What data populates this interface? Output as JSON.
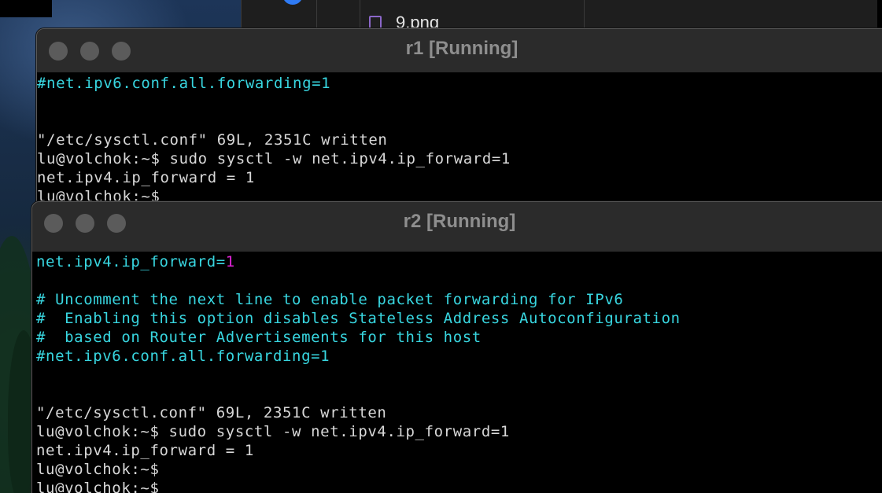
{
  "finder": {
    "file_name": "9.png",
    "file_icon": "image-file-icon"
  },
  "r1": {
    "title": "r1 [Running]",
    "lines": [
      "#net.ipv6.conf.all.forwarding=1",
      "",
      "",
      "\"/etc/sysctl.conf\" 69L, 2351C written",
      "lu@volchok:~$ sudo sysctl -w net.ipv4.ip_forward=1",
      "net.ipv4.ip_forward = 1",
      "lu@volchok:~$"
    ]
  },
  "r2": {
    "title": "r2 [Running]",
    "line0_key": "net.ipv4.ip_forward=",
    "line0_val": "1",
    "lines": [
      "",
      "# Uncomment the next line to enable packet forwarding for IPv6",
      "#  Enabling this option disables Stateless Address Autoconfiguration",
      "#  based on Router Advertisements for this host",
      "#net.ipv6.conf.all.forwarding=1",
      "",
      "",
      "\"/etc/sysctl.conf\" 69L, 2351C written",
      "lu@volchok:~$ sudo sysctl -w net.ipv4.ip_forward=1",
      "net.ipv4.ip_forward = 1",
      "lu@volchok:~$",
      "lu@volchok:~$"
    ]
  },
  "colors": {
    "terminal_bg": "#000000",
    "comment_cyan": "#38d6e0",
    "value_magenta": "#e024d8",
    "plain_text": "#d8d8d8",
    "title_text": "#8e8e8e"
  }
}
